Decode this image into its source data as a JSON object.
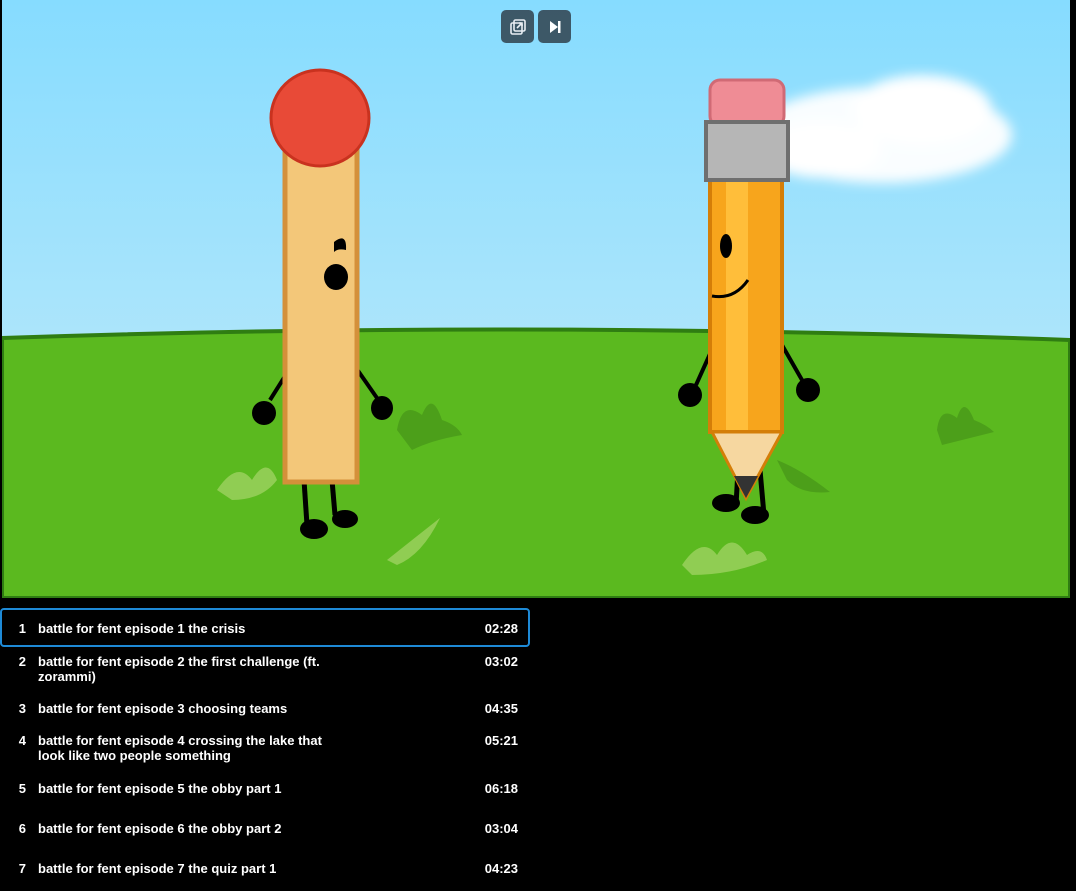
{
  "player": {
    "controls": [
      {
        "name": "popout-button",
        "icon": "popout-icon"
      },
      {
        "name": "next-button",
        "icon": "skip-next-icon"
      }
    ]
  },
  "playlist": {
    "items": [
      {
        "num": "1",
        "title": "battle for fent episode 1 the crisis",
        "duration": "02:28"
      },
      {
        "num": "2",
        "title": "battle for fent episode 2 the first challenge (ft. zorammi)",
        "duration": "03:02"
      },
      {
        "num": "3",
        "title": "battle for fent episode 3 choosing teams",
        "duration": "04:35"
      },
      {
        "num": "4",
        "title": "battle for fent episode 4 crossing the lake that look like two people something",
        "duration": "05:21"
      },
      {
        "num": "5",
        "title": "battle for fent episode 5 the obby part 1",
        "duration": "06:18"
      },
      {
        "num": "6",
        "title": "battle for fent episode 6 the obby part 2",
        "duration": "03:04"
      },
      {
        "num": "7",
        "title": "battle for fent episode 7 the quiz part 1",
        "duration": "04:23"
      }
    ],
    "active_index": 0
  },
  "colors": {
    "accent": "#1e8ad6",
    "sky_top": "#86dcff",
    "grass": "#5bb91f"
  }
}
